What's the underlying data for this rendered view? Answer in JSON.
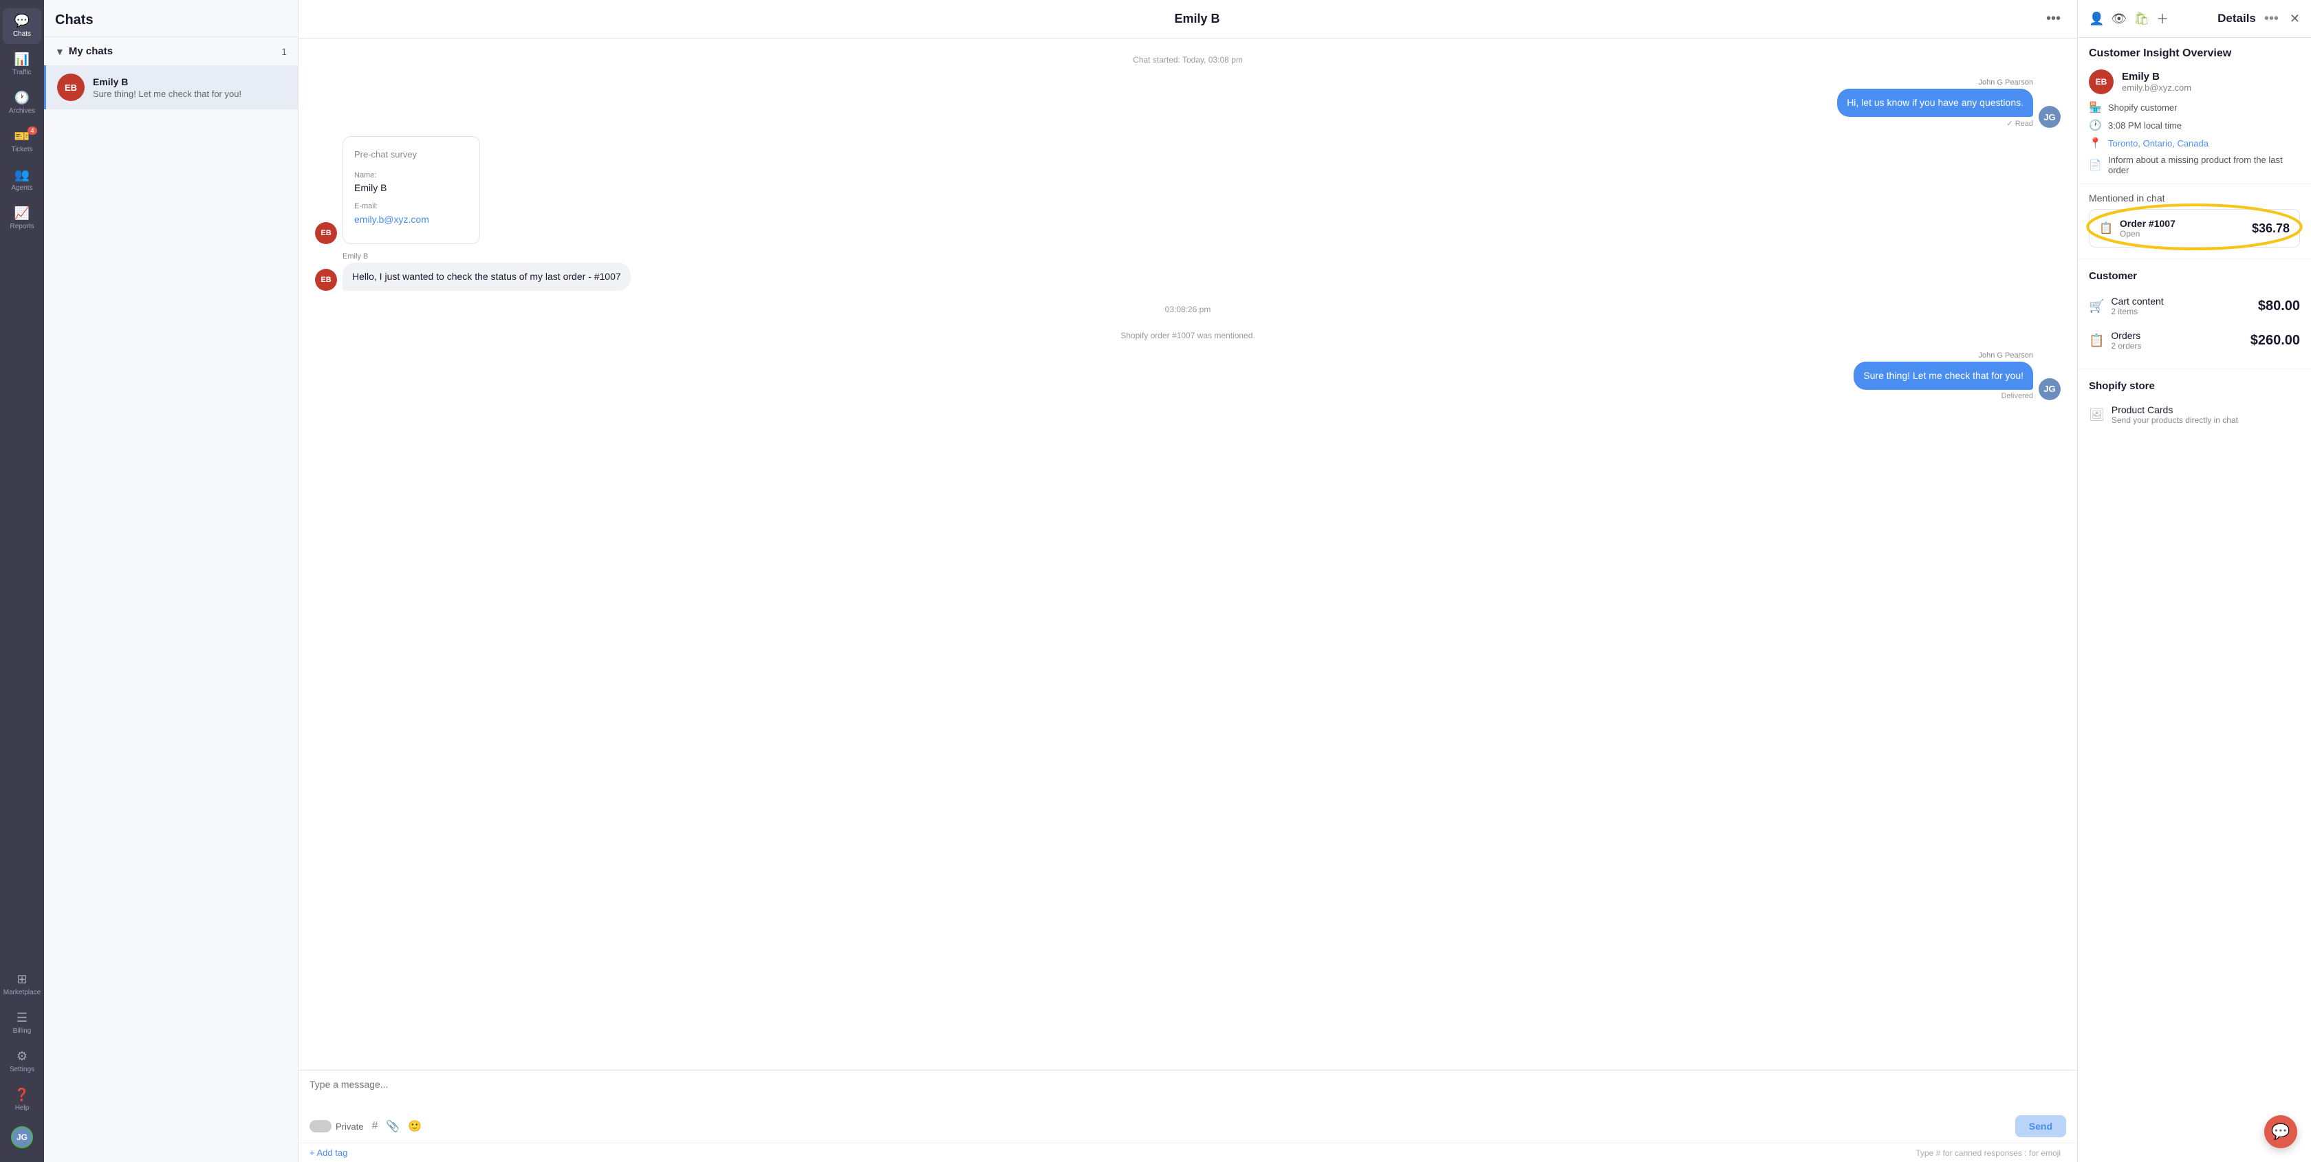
{
  "sidebar": {
    "items": [
      {
        "id": "chats",
        "label": "Chats",
        "icon": "💬",
        "active": true,
        "badge": null
      },
      {
        "id": "traffic",
        "label": "Traffic",
        "icon": "📊",
        "active": false,
        "badge": null
      },
      {
        "id": "archives",
        "label": "Archives",
        "icon": "🕐",
        "active": false,
        "badge": null
      },
      {
        "id": "tickets",
        "label": "Tickets",
        "icon": "🎫",
        "active": false,
        "badge": "4"
      },
      {
        "id": "agents",
        "label": "Agents",
        "icon": "👥",
        "active": false,
        "badge": null
      },
      {
        "id": "reports",
        "label": "Reports",
        "icon": "📈",
        "active": false,
        "badge": null
      },
      {
        "id": "marketplace",
        "label": "Marketplace",
        "icon": "⊞",
        "active": false,
        "badge": null
      },
      {
        "id": "billing",
        "label": "Billing",
        "icon": "≡",
        "active": false,
        "badge": null
      },
      {
        "id": "settings",
        "label": "Settings",
        "icon": "⚙",
        "active": false,
        "badge": null
      },
      {
        "id": "help",
        "label": "Help",
        "icon": "?",
        "active": false,
        "badge": null
      }
    ],
    "user_initials": "JG",
    "user_status_color": "#4caf50"
  },
  "chat_list": {
    "header": "Chats",
    "my_chats_label": "My chats",
    "my_chats_count": "1",
    "items": [
      {
        "id": "emily_b",
        "name": "Emily B",
        "preview": "Sure thing! Let me check that for you!",
        "initials": "EB",
        "avatar_color": "#c0392b",
        "active": true
      }
    ]
  },
  "chat_header": {
    "title": "Emily B",
    "more_icon": "•••"
  },
  "messages": [
    {
      "type": "divider",
      "text": "Chat started: Today, 03:08 pm"
    },
    {
      "type": "agent",
      "sender": "John G Pearson",
      "text": "Hi, let us know if you have any questions.",
      "status": "✓ Read",
      "avatar_type": "photo"
    },
    {
      "type": "survey",
      "sender_avatar": "EB",
      "title": "Pre-chat survey",
      "name_label": "Name:",
      "name_value": "Emily B",
      "email_label": "E-mail:",
      "email_value": "emily.b@xyz.com"
    },
    {
      "type": "customer",
      "sender": "Emily B",
      "sender_avatar": "EB",
      "text": "Hello, I just wanted to check the status of my last order - #1007"
    },
    {
      "type": "divider",
      "text": "03:08:26 pm"
    },
    {
      "type": "divider_sub",
      "text": "Shopify order #1007 was mentioned."
    },
    {
      "type": "agent",
      "sender": "John G Pearson",
      "text": "Sure thing! Let me check that for you!",
      "status": "Delivered",
      "avatar_type": "photo"
    }
  ],
  "input": {
    "placeholder": "Type a message...",
    "private_label": "Private",
    "send_label": "Send",
    "add_tag_label": "+ Add tag",
    "keyboard_hint": "Type # for canned responses : for emoji"
  },
  "details": {
    "title": "Details",
    "more_icon": "•••",
    "close_icon": "✕",
    "insight_title": "Customer Insight Overview",
    "customer": {
      "name": "Emily B",
      "email": "emily.b@xyz.com",
      "initials": "EB",
      "avatar_color": "#c0392b",
      "shopify_label": "Shopify customer",
      "local_time": "3:08 PM local time",
      "location": "Toronto, Ontario, Canada",
      "note": "Inform about a missing product from the last order"
    },
    "mentioned_label": "Mentioned in chat",
    "order": {
      "name": "Order #1007",
      "status": "Open",
      "amount": "$36.78",
      "icon": "📋"
    },
    "customer_section_title": "Customer",
    "metrics": [
      {
        "icon": "🛒",
        "name": "Cart content",
        "sub": "2 items",
        "value": "$80.00"
      },
      {
        "icon": "📋",
        "name": "Orders",
        "sub": "2 orders",
        "value": "$260.00"
      }
    ],
    "shopify_store_title": "Shopify store",
    "product_cards": {
      "name": "Product Cards",
      "desc": "Send your products directly in chat",
      "icon": "🖼"
    }
  }
}
